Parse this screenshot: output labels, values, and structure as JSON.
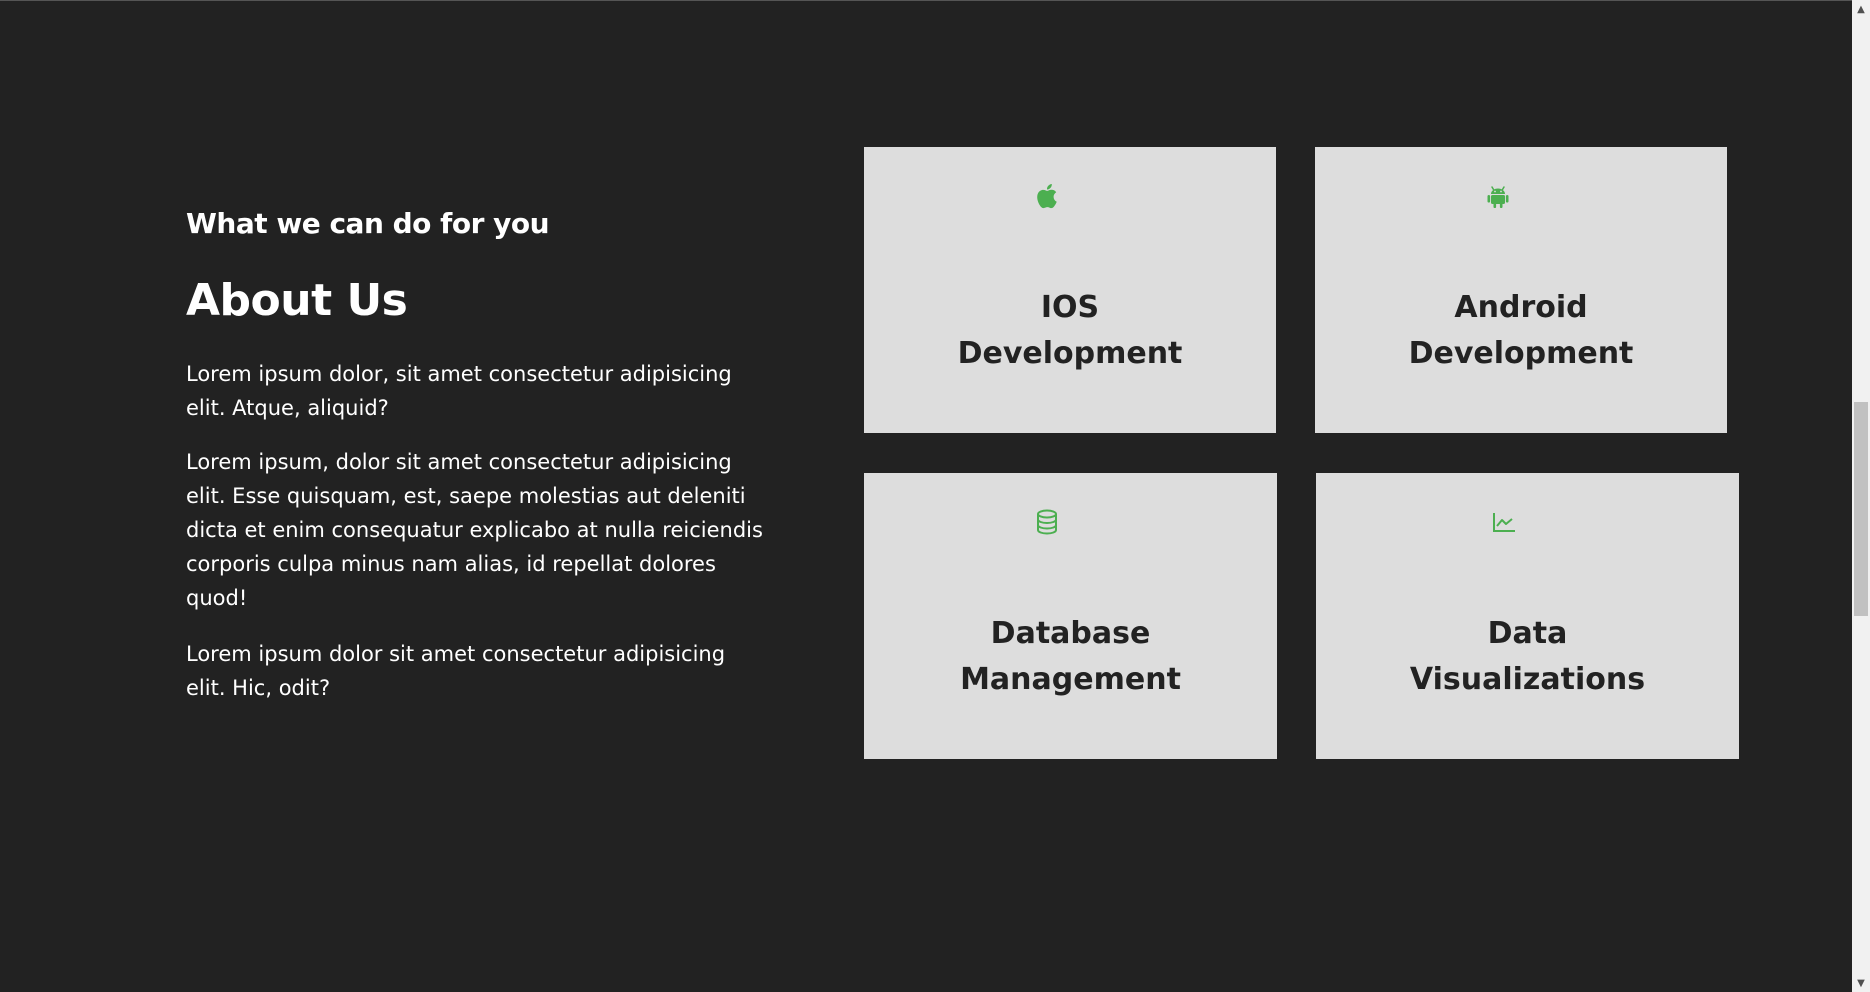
{
  "about": {
    "subtitle": "What we can do for you",
    "title": "About Us",
    "paragraphs": [
      "Lorem ipsum dolor, sit amet consectetur adipisicing elit. Atque, aliquid?",
      "Lorem ipsum, dolor sit amet consectetur adipisicing elit. Esse quisquam, est, saepe molestias aut deleniti dicta et enim consequatur explicabo at nulla reiciendis corporis culpa minus nam alias, id repellat dolores quod!",
      "Lorem ipsum dolor sit amet consectetur adipisicing elit. Hic, odit?"
    ]
  },
  "services": [
    {
      "icon": "apple-icon",
      "line1": "IOS",
      "line2": "Development"
    },
    {
      "icon": "android-icon",
      "line1": "Android",
      "line2": "Development"
    },
    {
      "icon": "database-icon",
      "line1": "Database",
      "line2": "Management"
    },
    {
      "icon": "chart-line-icon",
      "line1": "Data",
      "line2": "Visualizations"
    }
  ],
  "colors": {
    "background": "#222222",
    "card": "#dddddd",
    "accent": "#4caf50",
    "text_light": "#ffffff",
    "text_dark": "#222222"
  }
}
